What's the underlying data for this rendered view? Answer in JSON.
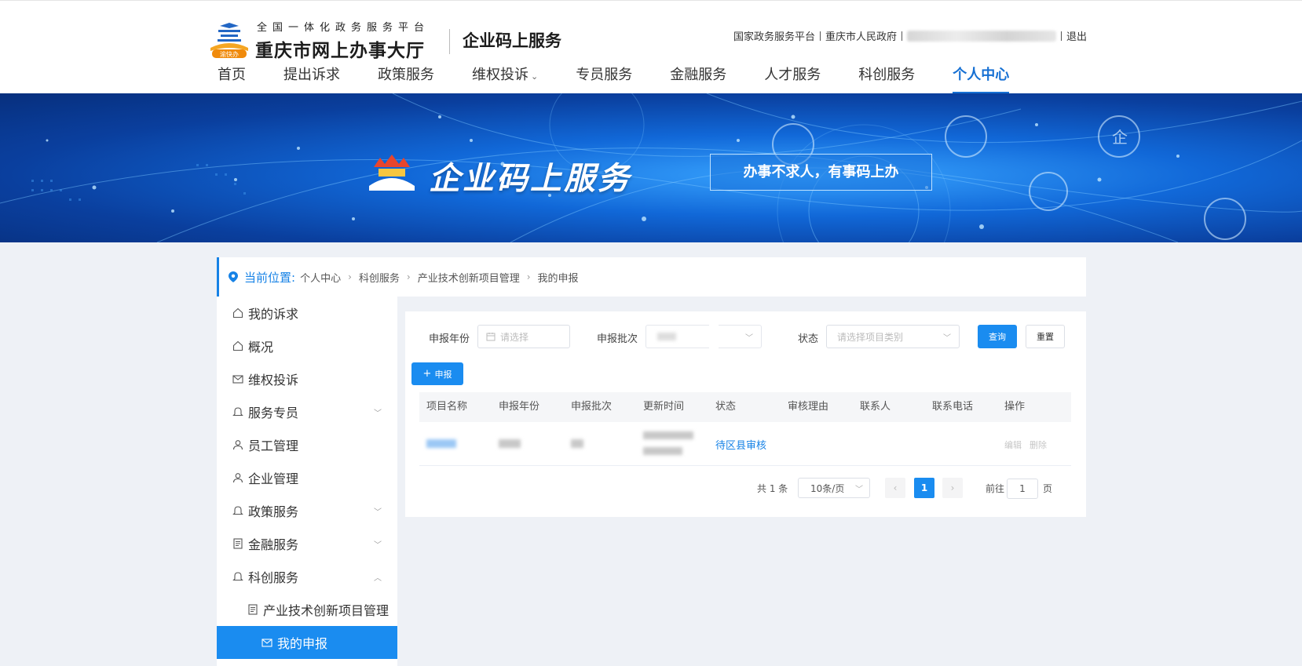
{
  "header": {
    "logo_badge": "渝快办",
    "platform_sub": "全国一体化政务服务平台",
    "platform_main": "重庆市网上办事大厅",
    "service_title": "企业码上服务",
    "top_links": [
      "国家政务服务平台",
      "重庆市人民政府"
    ],
    "logout": "退出"
  },
  "nav": {
    "items": [
      {
        "label": "首页"
      },
      {
        "label": "提出诉求"
      },
      {
        "label": "政策服务"
      },
      {
        "label": "维权投诉",
        "dropdown": true
      },
      {
        "label": "专员服务"
      },
      {
        "label": "金融服务"
      },
      {
        "label": "人才服务"
      },
      {
        "label": "科创服务"
      },
      {
        "label": "个人中心",
        "active": true
      }
    ],
    "accent_color": "#1670d3"
  },
  "banner": {
    "title": "企业码上服务",
    "slogan": "办事不求人，有事码上办",
    "icon_text": "企"
  },
  "breadcrumb": {
    "label": "当前位置:",
    "items": [
      "个人中心",
      "科创服务",
      "产业技术创新项目管理",
      "我的申报"
    ]
  },
  "sidebar": {
    "items": [
      {
        "label": "我的诉求",
        "icon": "home-icon"
      },
      {
        "label": "概况",
        "icon": "home-icon"
      },
      {
        "label": "维权投诉",
        "icon": "mail-icon"
      },
      {
        "label": "服务专员",
        "icon": "bell-icon",
        "arrow": "down"
      },
      {
        "label": "员工管理",
        "icon": "user-icon"
      },
      {
        "label": "企业管理",
        "icon": "user-icon"
      },
      {
        "label": "政策服务",
        "icon": "bell-icon",
        "arrow": "down"
      },
      {
        "label": "金融服务",
        "icon": "document-icon",
        "arrow": "down"
      },
      {
        "label": "科创服务",
        "icon": "bell-icon",
        "arrow": "up"
      },
      {
        "label": "产业技术创新项目管理",
        "icon": "document-icon",
        "sub": true
      },
      {
        "label": "我的申报",
        "icon": "mail-icon",
        "active": true
      }
    ],
    "active_color": "#1a8cf0"
  },
  "filters": {
    "year_label": "申报年份",
    "year_placeholder": "请选择",
    "batch_label": "申报批次",
    "batch_value": "",
    "status_label": "状态",
    "status_placeholder": "请选择项目类别",
    "query_button": "查询",
    "reset_button": "重置",
    "add_button": "申报"
  },
  "table": {
    "columns": [
      "项目名称",
      "申报年份",
      "申报批次",
      "更新时间",
      "状态",
      "审核理由",
      "联系人",
      "联系电话",
      "操作"
    ],
    "rows": [
      {
        "status": "待区县审核",
        "reason": "",
        "contact": "",
        "phone": "",
        "actions": [
          "编辑",
          "删除"
        ]
      }
    ]
  },
  "pagination": {
    "total_text": "共 1 条",
    "page_size": "10条/页",
    "current_page": "1",
    "goto_label": "前往",
    "goto_value": "1",
    "page_suffix": "页"
  }
}
